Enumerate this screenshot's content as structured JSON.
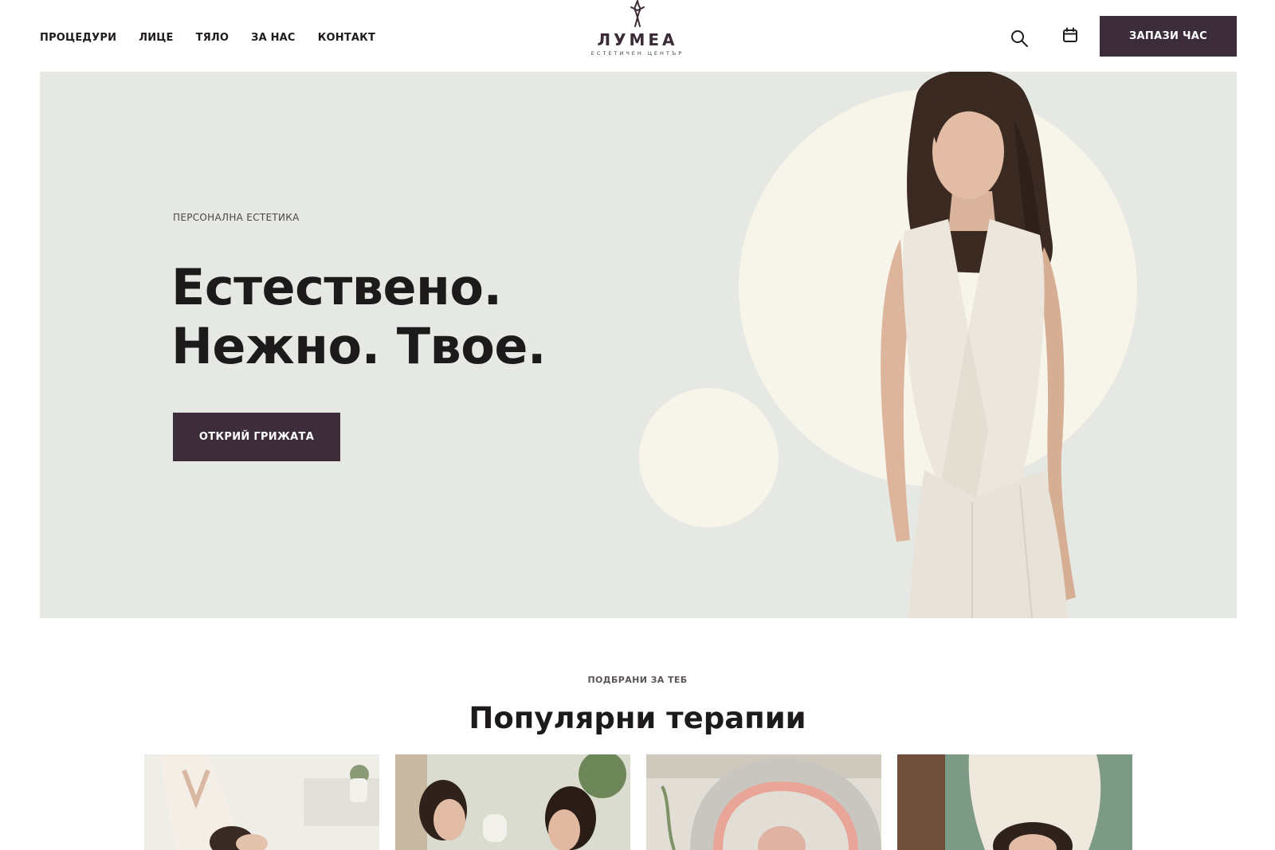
{
  "header": {
    "nav": [
      {
        "label": "ПРОЦЕДУРИ"
      },
      {
        "label": "ЛИЦЕ"
      },
      {
        "label": "ТЯЛО"
      },
      {
        "label": "ЗА НАС"
      },
      {
        "label": "КОНТАКТ"
      }
    ],
    "logo": {
      "name": "ЛУМЕА",
      "subtitle": "ЕСТЕТИЧЕН ЦЕНТЪР"
    },
    "search_icon": "search-icon",
    "calendar_icon": "calendar-icon",
    "book_label": "ЗАПАЗИ ЧАС"
  },
  "hero": {
    "eyebrow": "ПЕРСОНАЛНА ЕСТЕТИКА",
    "title_line1": "Естествено.",
    "title_line2": "Нежно. Твое.",
    "cta_label": "ОТКРИЙ ГРИЖАТА",
    "background_color": "#e6e9e3",
    "accent_color": "#3d2d3b"
  },
  "section": {
    "eyebrow": "ПОДБРАНИ ЗА ТЕБ",
    "title": "Популярни терапии"
  }
}
